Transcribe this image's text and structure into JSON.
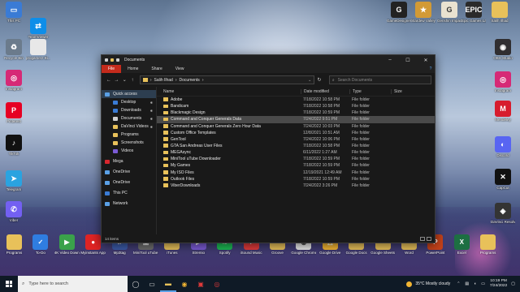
{
  "desktop_left": [
    {
      "name": "this-pc-desktop-icon",
      "label": "This PC",
      "color": "#3a7bd5",
      "glyph": "▭"
    },
    {
      "name": "teamviewer-desktop-icon",
      "label": "TeamViewer",
      "color": "#0e8ee9",
      "glyph": "⇄"
    },
    {
      "name": "recycle-bin-desktop-icon",
      "label": "Recycle Bin",
      "color": "#6b7b8c",
      "glyph": "♻"
    },
    {
      "name": "progamerz-desktop-icon",
      "label": "progamerz Bi...",
      "color": "#e8e8e8",
      "glyph": ""
    },
    {
      "name": "instagram-desktop-icon",
      "label": "Instagram",
      "color": "#d62976",
      "glyph": "◎"
    },
    {
      "name": "pinterest-desktop-icon",
      "label": "Pinterest",
      "color": "#e60023",
      "glyph": "P"
    },
    {
      "name": "tiktok-desktop-icon",
      "label": "TikTok",
      "color": "#111111",
      "glyph": "♪"
    },
    {
      "name": "telegram-desktop-icon",
      "label": "Telegram",
      "color": "#2aa3e0",
      "glyph": "➤"
    },
    {
      "name": "viber-desktop-icon",
      "label": "Viber",
      "color": "#7360f2",
      "glyph": "✆"
    }
  ],
  "desktop_top": [
    {
      "name": "gamedesigner-desktop-icon",
      "label": "GameDesigner",
      "color": "#222222",
      "glyph": "G"
    },
    {
      "name": "stardew-valley-desktop-icon",
      "label": "Stardew Valley",
      "color": "#d29a35",
      "glyph": "★"
    },
    {
      "name": "genshin-impact-desktop-icon",
      "label": "Genshin Impact",
      "color": "#e9e2d0",
      "glyph": "G"
    },
    {
      "name": "epic-games-desktop-icon",
      "label": "Epic Games Launcher",
      "color": "#2a2a2a",
      "glyph": "EPIC"
    },
    {
      "name": "salih-ilhad-desktop-icon",
      "label": "Salih Ilhad",
      "color": "#e8c15a",
      "glyph": ""
    }
  ],
  "desktop_right": [
    {
      "name": "obs-studio-desktop-icon",
      "label": "OBS Studio",
      "color": "#302e31",
      "glyph": "◉"
    },
    {
      "name": "instagram-right-desktop-icon",
      "label": "Instagram",
      "color": "#d62976",
      "glyph": "◎"
    },
    {
      "name": "mendeley-desktop-icon",
      "label": "Mendeley",
      "color": "#d71c2d",
      "glyph": "M"
    },
    {
      "name": "discord-desktop-icon",
      "label": "Discord",
      "color": "#5865f2",
      "glyph": "◐"
    },
    {
      "name": "capcut-desktop-icon",
      "label": "CapCut",
      "color": "#111111",
      "glyph": "✕"
    },
    {
      "name": "davinci-resolve-desktop-icon",
      "label": "DaVinci Resolve",
      "color": "#343434",
      "glyph": "◈"
    }
  ],
  "taskrow": [
    {
      "name": "programs-taskrow-icon",
      "label": "Programs",
      "color": "#e8c15a",
      "glyph": ""
    },
    {
      "name": "to-do-taskrow-icon",
      "label": "To-Do",
      "color": "#2f7de1",
      "glyph": "✓"
    },
    {
      "name": "4k-video-downloader-taskrow-icon",
      "label": "4K Video Downloader",
      "color": "#3aa14a",
      "glyph": "▶"
    },
    {
      "name": "myinstants-taskrow-icon",
      "label": "Myinstants App",
      "color": "#e02424",
      "glyph": "●"
    },
    {
      "name": "mp3tag-taskrow-icon",
      "label": "Mp3tag",
      "color": "#3c5aa6",
      "glyph": "♫"
    },
    {
      "name": "minitool-taskrow-icon",
      "label": "MiniTool uTube Do...",
      "color": "#6d6d6d",
      "glyph": "▣"
    },
    {
      "name": "itunes-taskrow-icon",
      "label": "iTunes",
      "color": "#e8c15a",
      "glyph": ""
    },
    {
      "name": "stremio-taskrow-icon",
      "label": "Stremio",
      "color": "#7b5bd6",
      "glyph": "▶"
    },
    {
      "name": "spotify-taskrow-icon",
      "label": "Spotify",
      "color": "#1db954",
      "glyph": "≋"
    },
    {
      "name": "isound-music-taskrow-icon",
      "label": "iSound Music",
      "color": "#e03a3a",
      "glyph": "♪"
    },
    {
      "name": "groove-taskrow-icon",
      "label": "Groove",
      "color": "#e8c15a",
      "glyph": ""
    },
    {
      "name": "google-chrome-taskrow-icon",
      "label": "Google Chrome",
      "color": "#e8e8e8",
      "glyph": "◉"
    },
    {
      "name": "google-drive-taskrow-icon",
      "label": "Google Drive",
      "color": "#f2b533",
      "glyph": "△"
    },
    {
      "name": "google-docs-taskrow-icon",
      "label": "Google Docs",
      "color": "#e8c15a",
      "glyph": ""
    },
    {
      "name": "google-sheets-taskrow-icon",
      "label": "Google Sheets",
      "color": "#e8c15a",
      "glyph": ""
    },
    {
      "name": "word-taskrow-icon",
      "label": "Word",
      "color": "#e8c15a",
      "glyph": ""
    },
    {
      "name": "powerpoint-taskrow-icon",
      "label": "PowerPoint",
      "color": "#c4421a",
      "glyph": "P"
    },
    {
      "name": "excel-taskrow-icon",
      "label": "Excel",
      "color": "#1d6f42",
      "glyph": "X"
    },
    {
      "name": "programs-right-taskrow-icon",
      "label": "Programs",
      "color": "#e8c15a",
      "glyph": ""
    }
  ],
  "window": {
    "title": "Documents",
    "ribbon_tabs": [
      "File",
      "Home",
      "Share",
      "View"
    ],
    "breadcrumb": [
      "Salih Ilhad",
      "Documents"
    ],
    "search_placeholder": "Search Documents",
    "columns": {
      "name": "Name",
      "date": "Date modified",
      "type": "Type",
      "size": "Size"
    },
    "nav": [
      {
        "label": "Quick access",
        "sub": false,
        "pin": false,
        "sel": true,
        "color": "#5aa0e6",
        "gap": false
      },
      {
        "label": "Desktop",
        "sub": true,
        "pin": true,
        "sel": false,
        "color": "#3a7bd5",
        "gap": false
      },
      {
        "label": "Downloads",
        "sub": true,
        "pin": true,
        "sel": false,
        "color": "#3a7bd5",
        "gap": false
      },
      {
        "label": "Documents",
        "sub": true,
        "pin": true,
        "sel": false,
        "color": "#d0d0d0",
        "gap": false
      },
      {
        "label": "DaVinci Videos",
        "sub": true,
        "pin": true,
        "sel": false,
        "color": "#e8c15a",
        "gap": false
      },
      {
        "label": "Programs",
        "sub": true,
        "pin": false,
        "sel": false,
        "color": "#e8c15a",
        "gap": false
      },
      {
        "label": "Screenshots",
        "sub": true,
        "pin": false,
        "sel": false,
        "color": "#e8c15a",
        "gap": false
      },
      {
        "label": "Videos",
        "sub": true,
        "pin": false,
        "sel": false,
        "color": "#7b5bd6",
        "gap": false
      },
      {
        "label": "Mega",
        "sub": false,
        "pin": false,
        "sel": false,
        "color": "#d9272e",
        "gap": true
      },
      {
        "label": "OneDrive",
        "sub": false,
        "pin": false,
        "sel": false,
        "color": "#5aa0e6",
        "gap": true
      },
      {
        "label": "OneDrive",
        "sub": false,
        "pin": false,
        "sel": false,
        "color": "#5aa0e6",
        "gap": true
      },
      {
        "label": "This PC",
        "sub": false,
        "pin": false,
        "sel": false,
        "color": "#3a7bd5",
        "gap": true
      },
      {
        "label": "Network",
        "sub": false,
        "pin": false,
        "sel": false,
        "color": "#5aa0e6",
        "gap": true
      }
    ],
    "files": [
      {
        "name": "Adobe",
        "date": "7/18/2022 10:58 PM",
        "type": "File folder",
        "hl": false
      },
      {
        "name": "Bandicam",
        "date": "7/18/2022 10:58 PM",
        "type": "File folder",
        "hl": false
      },
      {
        "name": "Blackmagic Design",
        "date": "7/18/2022 10:59 PM",
        "type": "File folder",
        "hl": false
      },
      {
        "name": "Command and Conquer Generals Data",
        "date": "7/24/2022 9:51 PM",
        "type": "File folder",
        "hl": true
      },
      {
        "name": "Command and Conquer Generals Zero Hour Data",
        "date": "7/24/2022 10:03 PM",
        "type": "File folder",
        "hl": false
      },
      {
        "name": "Custom Office Templates",
        "date": "12/8/2021 10:51 AM",
        "type": "File folder",
        "hl": false
      },
      {
        "name": "GenTool",
        "date": "7/24/2022 10:06 PM",
        "type": "File folder",
        "hl": false
      },
      {
        "name": "GTA San Andreas User Files",
        "date": "7/18/2022 10:58 PM",
        "type": "File folder",
        "hl": false
      },
      {
        "name": "MEGAsync",
        "date": "6/11/2022 1:27 AM",
        "type": "File folder",
        "hl": false
      },
      {
        "name": "MiniTool uTube Downloader",
        "date": "7/18/2022 10:59 PM",
        "type": "File folder",
        "hl": false
      },
      {
        "name": "My Games",
        "date": "7/18/2022 10:59 PM",
        "type": "File folder",
        "hl": false
      },
      {
        "name": "My ISO Files",
        "date": "12/19/2021 12:49 AM",
        "type": "File folder",
        "hl": false
      },
      {
        "name": "Outlook Files",
        "date": "7/18/2022 10:59 PM",
        "type": "File folder",
        "hl": false
      },
      {
        "name": "ViberDownloads",
        "date": "7/24/2022 3:26 PM",
        "type": "File folder",
        "hl": false
      }
    ],
    "status": "14 items"
  },
  "taskbar": {
    "search_placeholder": "Type here to search",
    "weather": "35°C  Mostly cloudy",
    "time": "10:19 PM",
    "date": "7/24/2022"
  }
}
